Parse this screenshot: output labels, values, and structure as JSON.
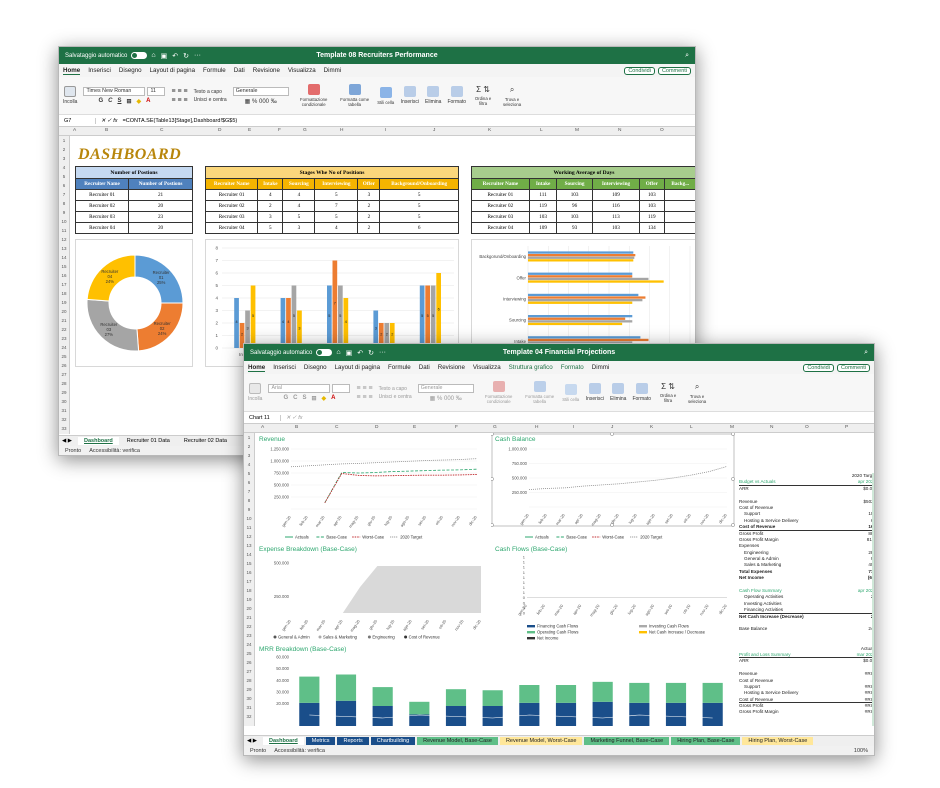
{
  "win1": {
    "autosave": "Salvataggio automatico",
    "title": "Template 08 Recruiters Performance",
    "menu": [
      "Home",
      "Inserisci",
      "Disegno",
      "Layout di pagina",
      "Formule",
      "Dati",
      "Revisione",
      "Visualizza",
      "Dimmi"
    ],
    "share": "Condividi",
    "comments": "Commenti",
    "ribbon": {
      "paste": "Incolla",
      "font": "Times New Roman",
      "size": "11",
      "wrap": "Testo a capo",
      "merge": "Unisci e centra",
      "numfmt": "Generale",
      "cond": "Formattazione condizionale",
      "astable": "Formatta come tabella",
      "styles": "Stili cella",
      "insert": "Inserisci",
      "delete": "Elimina",
      "format": "Formato",
      "sort": "Ordina e filtra",
      "find": "Trova e seleziona"
    },
    "cellref": "G7",
    "formula": "=CONTA.SE(Table13[Stage],Dashboard!$G$5)",
    "columns": [
      "A",
      "B",
      "C",
      "D",
      "E",
      "F",
      "G",
      "H",
      "I",
      "J",
      "K",
      "L",
      "M",
      "N",
      "O",
      "P"
    ],
    "dashboard_title": "DASHBOARD",
    "positions": {
      "title": "Number of Postions",
      "headers": [
        "Recruiter Name",
        "Number of Postions"
      ],
      "rows": [
        [
          "Recruiter 01",
          "21"
        ],
        [
          "Recruiter 02",
          "20"
        ],
        [
          "Recruiter 03",
          "23"
        ],
        [
          "Recruiter 04",
          "20"
        ]
      ]
    },
    "stages": {
      "title": "Stages Whe No of Positions",
      "headers": [
        "Recruiter Name",
        "Intake",
        "Sourcing",
        "Interviewing",
        "Offer",
        "Background/Onboarding"
      ],
      "rows": [
        [
          "Recruiter 01",
          "4",
          "4",
          "5",
          "3",
          "5"
        ],
        [
          "Recruiter 02",
          "2",
          "4",
          "7",
          "2",
          "5"
        ],
        [
          "Recruiter 03",
          "3",
          "5",
          "5",
          "2",
          "5"
        ],
        [
          "Recruiter 04",
          "5",
          "3",
          "4",
          "2",
          "6"
        ]
      ]
    },
    "working": {
      "title": "Working Average of Days",
      "headers": [
        "Recruiter Name",
        "Intake",
        "Sourcing",
        "Interviewing",
        "Offer",
        "Backg..."
      ],
      "rows": [
        [
          "Recruiter 01",
          "111",
          "103",
          "109",
          "103"
        ],
        [
          "Recruiter 02",
          "119",
          "96",
          "116",
          "103"
        ],
        [
          "Recruiter 03",
          "103",
          "103",
          "113",
          "119"
        ],
        [
          "Recruiter 04",
          "109",
          "93",
          "103",
          "134"
        ]
      ]
    },
    "tabs": [
      "Dashboard",
      "Recruiter 01 Data",
      "Recruiter 02 Data"
    ],
    "status": [
      "Pronto",
      "Accessibilità: verifica"
    ]
  },
  "win2": {
    "autosave": "Salvataggio automatico",
    "title": "Template 04 Financial Projections",
    "menu": [
      "Home",
      "Inserisci",
      "Disegno",
      "Layout di pagina",
      "Formule",
      "Dati",
      "Revisione",
      "Visualizza",
      "Struttura grafico",
      "Formato",
      "Dimmi"
    ],
    "share": "Condividi",
    "comments": "Commenti",
    "ribbon": {
      "paste": "Incolla",
      "font": "Arial",
      "wrap": "Testo a capo",
      "merge": "Unisci e centra",
      "numfmt": "Generale",
      "cond": "Formattazione condizionale",
      "astable": "Formatta come tabella",
      "styles": "Stili cella",
      "insert": "Inserisci",
      "delete": "Elimina",
      "format": "Formato",
      "sort": "Ordina e filtra",
      "find": "Trova e seleziona"
    },
    "cellref": "Chart 11",
    "columns": [
      "A",
      "B",
      "C",
      "D",
      "E",
      "F",
      "G",
      "H",
      "I",
      "J",
      "K",
      "L",
      "M",
      "N",
      "O",
      "P"
    ],
    "side": {
      "target_label": "2020 Target",
      "pnl": "Budget vs Actuals",
      "apr": "apr 2020",
      "arr_val": "$0.0M",
      "lines": [
        [
          "Revenue",
          "$502k"
        ],
        [
          "Cost of Revenue",
          ""
        ],
        [
          "Support",
          "107"
        ],
        [
          "Hosting & Service Delivery",
          "61"
        ],
        [
          "Cost of Revenue",
          "168"
        ],
        [
          "Gross Profit",
          " 884"
        ],
        [
          "Gross Profit Margin",
          "81%"
        ],
        [
          "Expenses",
          ""
        ],
        [
          "Engineering",
          "283"
        ],
        [
          "General & Admin",
          "94"
        ],
        [
          "Sales & Marketing",
          "405"
        ],
        [
          "Total Expenses",
          "778"
        ],
        [
          "Net Income",
          "(60)"
        ]
      ],
      "cf_title": "Cash Flow Summary",
      "cf_lines": [
        [
          "Operating Activities",
          "23"
        ],
        [
          "Investing Activities",
          "-"
        ],
        [
          "Financing Activities",
          "-"
        ],
        [
          "Net Cash Increase (Decrease)",
          "23"
        ],
        [
          "",
          ""
        ],
        [
          "Base Balance",
          "243"
        ]
      ],
      "actuals_label": "Actuals",
      "pl_title": "Profit and Loss Summary",
      "mar": "mar 2020",
      "arr2": "$0.0M",
      "lines2": [
        [
          "Revenue",
          "#RIF!"
        ],
        [
          "Cost of Revenue",
          ""
        ],
        [
          "Support",
          "#RIF!"
        ],
        [
          "Hosting & Service Delivery",
          "#RIF!"
        ],
        [
          "Cost of Revenue",
          "#RIF!"
        ],
        [
          "Gross Profit",
          "#RIF!"
        ],
        [
          "Gross Profit Margin",
          "#RIF!"
        ]
      ]
    },
    "tabs": [
      "Dashboard",
      "Metrics",
      "Reports",
      "Chartbuilding",
      "Revenue Model, Base-Case",
      "Revenue Model, Worst-Case",
      "Marketing Funnel, Base-Case",
      "Hiring Plan, Base-Case",
      "Hiring Plan, Worst-Case"
    ],
    "status": [
      "Pronto",
      "Accessibilità: verifica"
    ],
    "zoom": "100%"
  },
  "chart_data": [
    {
      "type": "pie",
      "categories": [
        "Recruiter 01",
        "Recruiter 02",
        "Recruiter 03",
        "Recruiter 04"
      ],
      "values": [
        21,
        20,
        23,
        20
      ],
      "labels": [
        "Recruiter 01 25%",
        "Recruiter 02 24%",
        "Recruiter 03 27%",
        "Recruiter 04 24%"
      ],
      "colors": [
        "#5b9bd5",
        "#ed7d31",
        "#a5a5a5",
        "#ffc000"
      ]
    },
    {
      "type": "bar",
      "categories": [
        "Intake",
        "Sourcing",
        "Interviewing",
        "Offer",
        "Backgorund/Onboarding"
      ],
      "series": [
        {
          "values": [
            4,
            4,
            5,
            3,
            5
          ]
        },
        {
          "values": [
            2,
            4,
            7,
            2,
            5
          ]
        },
        {
          "values": [
            3,
            5,
            5,
            2,
            5
          ]
        },
        {
          "values": [
            5,
            3,
            4,
            2,
            6
          ]
        }
      ],
      "colors": [
        "#5b9bd5",
        "#ed7d31",
        "#a5a5a5",
        "#ffc000"
      ],
      "ylim": [
        0,
        8
      ]
    },
    {
      "type": "bar",
      "orientation": "horizontal",
      "categories": [
        "Intake",
        "Sourcing",
        "Interviewing",
        "Offer",
        "Backgorund/Onboarding"
      ],
      "series": [
        {
          "values": [
            111,
            103,
            109,
            103,
            104
          ]
        },
        {
          "values": [
            119,
            96,
            116,
            103,
            106
          ]
        },
        {
          "values": [
            103,
            103,
            113,
            119,
            105
          ]
        },
        {
          "values": [
            109,
            93,
            103,
            134,
            104
          ]
        }
      ],
      "colors": [
        "#5b9bd5",
        "#ed7d31",
        "#a5a5a5",
        "#ffc000"
      ],
      "xlim": [
        0,
        160
      ]
    },
    {
      "type": "line",
      "title": "Revenue",
      "x": [
        "gen-20",
        "feb-20",
        "mar-20",
        "apr-20",
        "mag-20",
        "giu-20",
        "lug-20",
        "ago-20",
        "set-20",
        "ott-20",
        "nov-20",
        "dic-20"
      ],
      "series": [
        {
          "name": "Actuals",
          "values": [
            null,
            null,
            130,
            null,
            null,
            null,
            null,
            null,
            null,
            null,
            null,
            null
          ]
        },
        {
          "name": "Base-Case",
          "values": [
            null,
            null,
            130,
            760,
            750,
            760,
            780,
            790,
            800,
            810,
            815,
            830
          ]
        },
        {
          "name": "Worst-Case",
          "values": [
            null,
            null,
            130,
            740,
            700,
            690,
            695,
            700,
            705,
            705,
            710,
            720
          ]
        },
        {
          "name": "2020 Target",
          "values": [
            880,
            900,
            920,
            940,
            950,
            965,
            980,
            995,
            1010,
            1020,
            1030,
            1050
          ]
        }
      ],
      "yticks": [
        "1.250.000",
        "1.000.000",
        "750.000",
        "500.000",
        "250.000",
        ""
      ],
      "ylim": [
        0,
        1250
      ]
    },
    {
      "type": "line",
      "title": "Cash Balance",
      "x": [
        "gen-20",
        "feb-20",
        "mar-20",
        "apr-20",
        "mag-20",
        "giu-20",
        "lug-20",
        "ago-20",
        "set-20",
        "ott-20",
        "nov-20",
        "dic-20"
      ],
      "series": [
        {
          "name": "Actuals",
          "values": [
            null,
            null,
            null,
            null,
            null,
            null,
            null,
            null,
            null,
            null,
            null,
            null
          ]
        },
        {
          "name": "Base-Case",
          "values": [
            null,
            null,
            null,
            null,
            null,
            null,
            null,
            null,
            null,
            null,
            null,
            null
          ]
        },
        {
          "name": "Worst-Case",
          "values": [
            null,
            null,
            null,
            null,
            null,
            null,
            null,
            null,
            null,
            null,
            null,
            null
          ]
        },
        {
          "name": "2020 Target",
          "values": [
            300,
            320,
            330,
            360,
            380,
            400,
            430,
            460,
            500,
            550,
            610,
            700
          ]
        }
      ],
      "yticks": [
        "1.000.000",
        "750.000",
        "500.000",
        "250.000",
        ""
      ],
      "ylim": [
        0,
        1000
      ]
    },
    {
      "type": "area",
      "title": "Expense Breakdown (Base-Case)",
      "x": [
        "gen-20",
        "feb-20",
        "mar-20",
        "apr-20",
        "mag-20",
        "giu-20",
        "lug-20",
        "ago-20",
        "set-20",
        "ott-20",
        "nov-20",
        "dic-20"
      ],
      "series": [
        {
          "name": "General & Admin",
          "values": [
            0,
            0,
            0,
            0,
            0,
            0,
            0,
            0,
            0,
            0,
            0,
            0
          ]
        },
        {
          "name": "Sales & Marketing",
          "values": [
            0,
            0,
            0,
            0,
            0,
            0,
            0,
            0,
            0,
            0,
            0,
            0
          ]
        },
        {
          "name": "Engineering",
          "values": [
            0,
            0,
            0,
            0,
            0,
            0,
            0,
            0,
            0,
            0,
            0,
            0
          ]
        },
        {
          "name": "Cost of Revenue",
          "values": [
            0,
            0,
            0,
            0,
            260,
            470,
            470,
            470,
            470,
            470,
            470,
            470
          ]
        }
      ],
      "yticks": [
        "500.000",
        "",
        "250.000",
        ""
      ],
      "ylim": [
        0,
        500
      ]
    },
    {
      "type": "bar",
      "title": "Cash Flows (Base-Case)",
      "x": [
        "gen-20",
        "feb-20",
        "mar-20",
        "apr-20",
        "mag-20",
        "giu-20",
        "lug-20",
        "ago-20",
        "set-20",
        "ott-20",
        "nov-20",
        "dic-20"
      ],
      "series": [
        {
          "name": "Financing Cash Flows",
          "values": []
        },
        {
          "name": "Investing Cash Flows",
          "values": []
        },
        {
          "name": "Operating Cash Flows",
          "values": []
        },
        {
          "name": "Net Cash Increase / Decrease",
          "values": []
        },
        {
          "name": "Net Income",
          "values": []
        }
      ],
      "yticks": [
        "1",
        "1",
        "1",
        "1",
        "1",
        "1",
        "1",
        "1",
        "0",
        "0",
        "0",
        "0"
      ]
    },
    {
      "type": "bar",
      "stacked": true,
      "title": "MRR Breakdown (Base-Case)",
      "categories": [
        "1",
        "2",
        "3",
        "4",
        "5",
        "6",
        "7",
        "8",
        "9",
        "10",
        "11",
        "12"
      ],
      "series": [
        {
          "values": [
            23,
            25,
            20,
            12,
            20,
            20,
            23,
            23,
            24,
            23,
            23,
            23
          ]
        },
        {
          "values": [
            25,
            25,
            18,
            12,
            16,
            15,
            17,
            17,
            19,
            19,
            19,
            19
          ]
        }
      ],
      "colors": [
        "#1a4e8a",
        "#5fbf88"
      ],
      "yticks": [
        "60.000",
        "50.000",
        "40.000",
        "30.000",
        "20.000"
      ],
      "ylim": [
        0,
        60
      ]
    }
  ]
}
